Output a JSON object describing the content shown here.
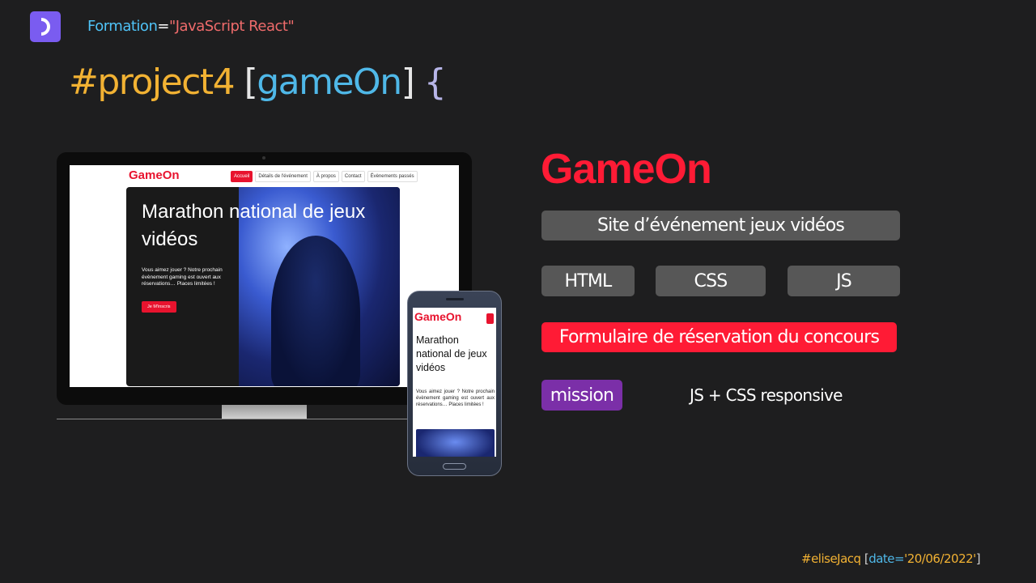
{
  "header": {
    "formation_key": "Formation",
    "formation_eq": "=",
    "formation_value": "\"JavaScript React\""
  },
  "title": {
    "hash": "#project4",
    "open_bracket": " [",
    "name": "gameOn",
    "close_bracket": "]",
    "brace": " {"
  },
  "desktop_site": {
    "logo": "GameOn",
    "nav": [
      "Accueil",
      "Détails de l'événement",
      "À propos",
      "Contact",
      "Évènements passés"
    ],
    "hero_title": "Marathon national de jeux vidéos",
    "hero_text": "Vous aimez jouer ? Notre prochain évènement gaming est ouvert aux réservations… Places limitées !",
    "hero_button": "Je M'inscris"
  },
  "mobile_site": {
    "logo": "GameOn",
    "hero_title": "Marathon national de jeux vidéos",
    "hero_text": "Vous aimez jouer ? Notre prochain évènement gaming est ouvert aux réservations… Places limitées !"
  },
  "brand": "GameOn",
  "tags": {
    "subtitle": "Site d’événement jeux vidéos",
    "tech1": "HTML",
    "tech2": "CSS",
    "tech3": "JS",
    "feature": "Formulaire de réservation du concours",
    "mission_label": "mission",
    "mission_desc": "JS + CSS responsive"
  },
  "footer": {
    "author": "#eliseJacq",
    "open": " [",
    "date_key": "date=",
    "date_value": "'20/06/2022'",
    "close": "]"
  },
  "colors": {
    "background": "#1e1e1f",
    "brand_red": "#ff1b35",
    "pill_gray": "#575757",
    "mission_purple": "#7b2fa8",
    "accent_yellow": "#f2b233",
    "accent_blue": "#4fb8e8"
  }
}
